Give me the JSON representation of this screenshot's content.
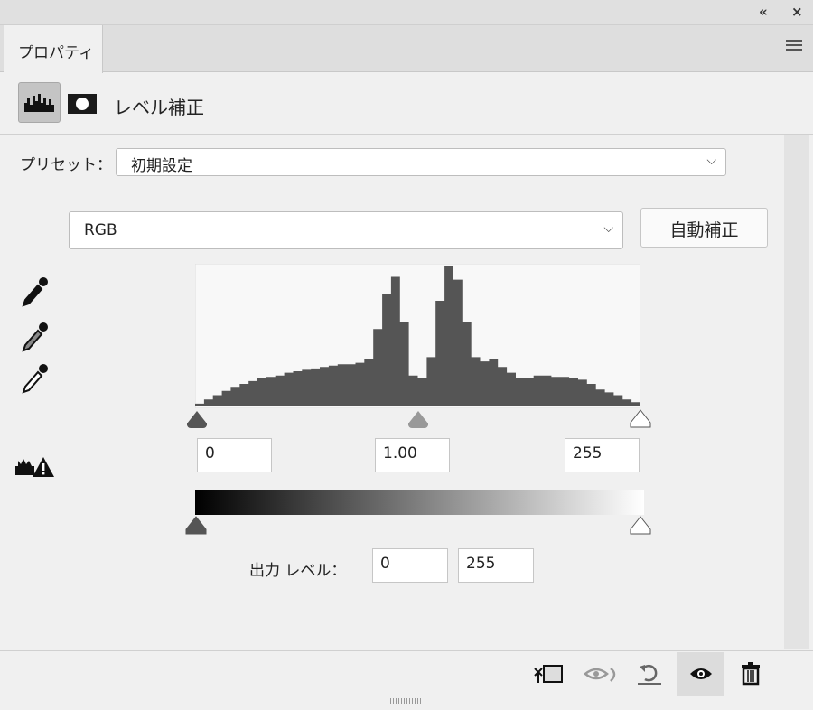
{
  "window": {
    "collapse_icon": "«",
    "close_icon": "×"
  },
  "tab": {
    "label": "プロパティ"
  },
  "header": {
    "title": "レベル補正"
  },
  "preset": {
    "label": "プリセット：",
    "value": "初期設定"
  },
  "channel": {
    "value": "RGB"
  },
  "auto_button": "自動補正",
  "input_levels": {
    "black": "0",
    "gamma": "1.00",
    "white": "255"
  },
  "output": {
    "label": "出力 レベル：",
    "black": "0",
    "white": "255"
  },
  "histogram": {
    "values": [
      2,
      5,
      8,
      11,
      14,
      16,
      18,
      20,
      21,
      22,
      24,
      25,
      26,
      27,
      28,
      29,
      30,
      30,
      31,
      34,
      55,
      80,
      92,
      60,
      22,
      20,
      35,
      75,
      100,
      90,
      60,
      35,
      32,
      34,
      28,
      24,
      20,
      20,
      22,
      22,
      21,
      21,
      20,
      19,
      16,
      12,
      10,
      8,
      5,
      3
    ],
    "color": "#555555"
  },
  "colors": {
    "slider_black": "#555555",
    "slider_mid": "#999999",
    "slider_white": "#ffffff"
  }
}
